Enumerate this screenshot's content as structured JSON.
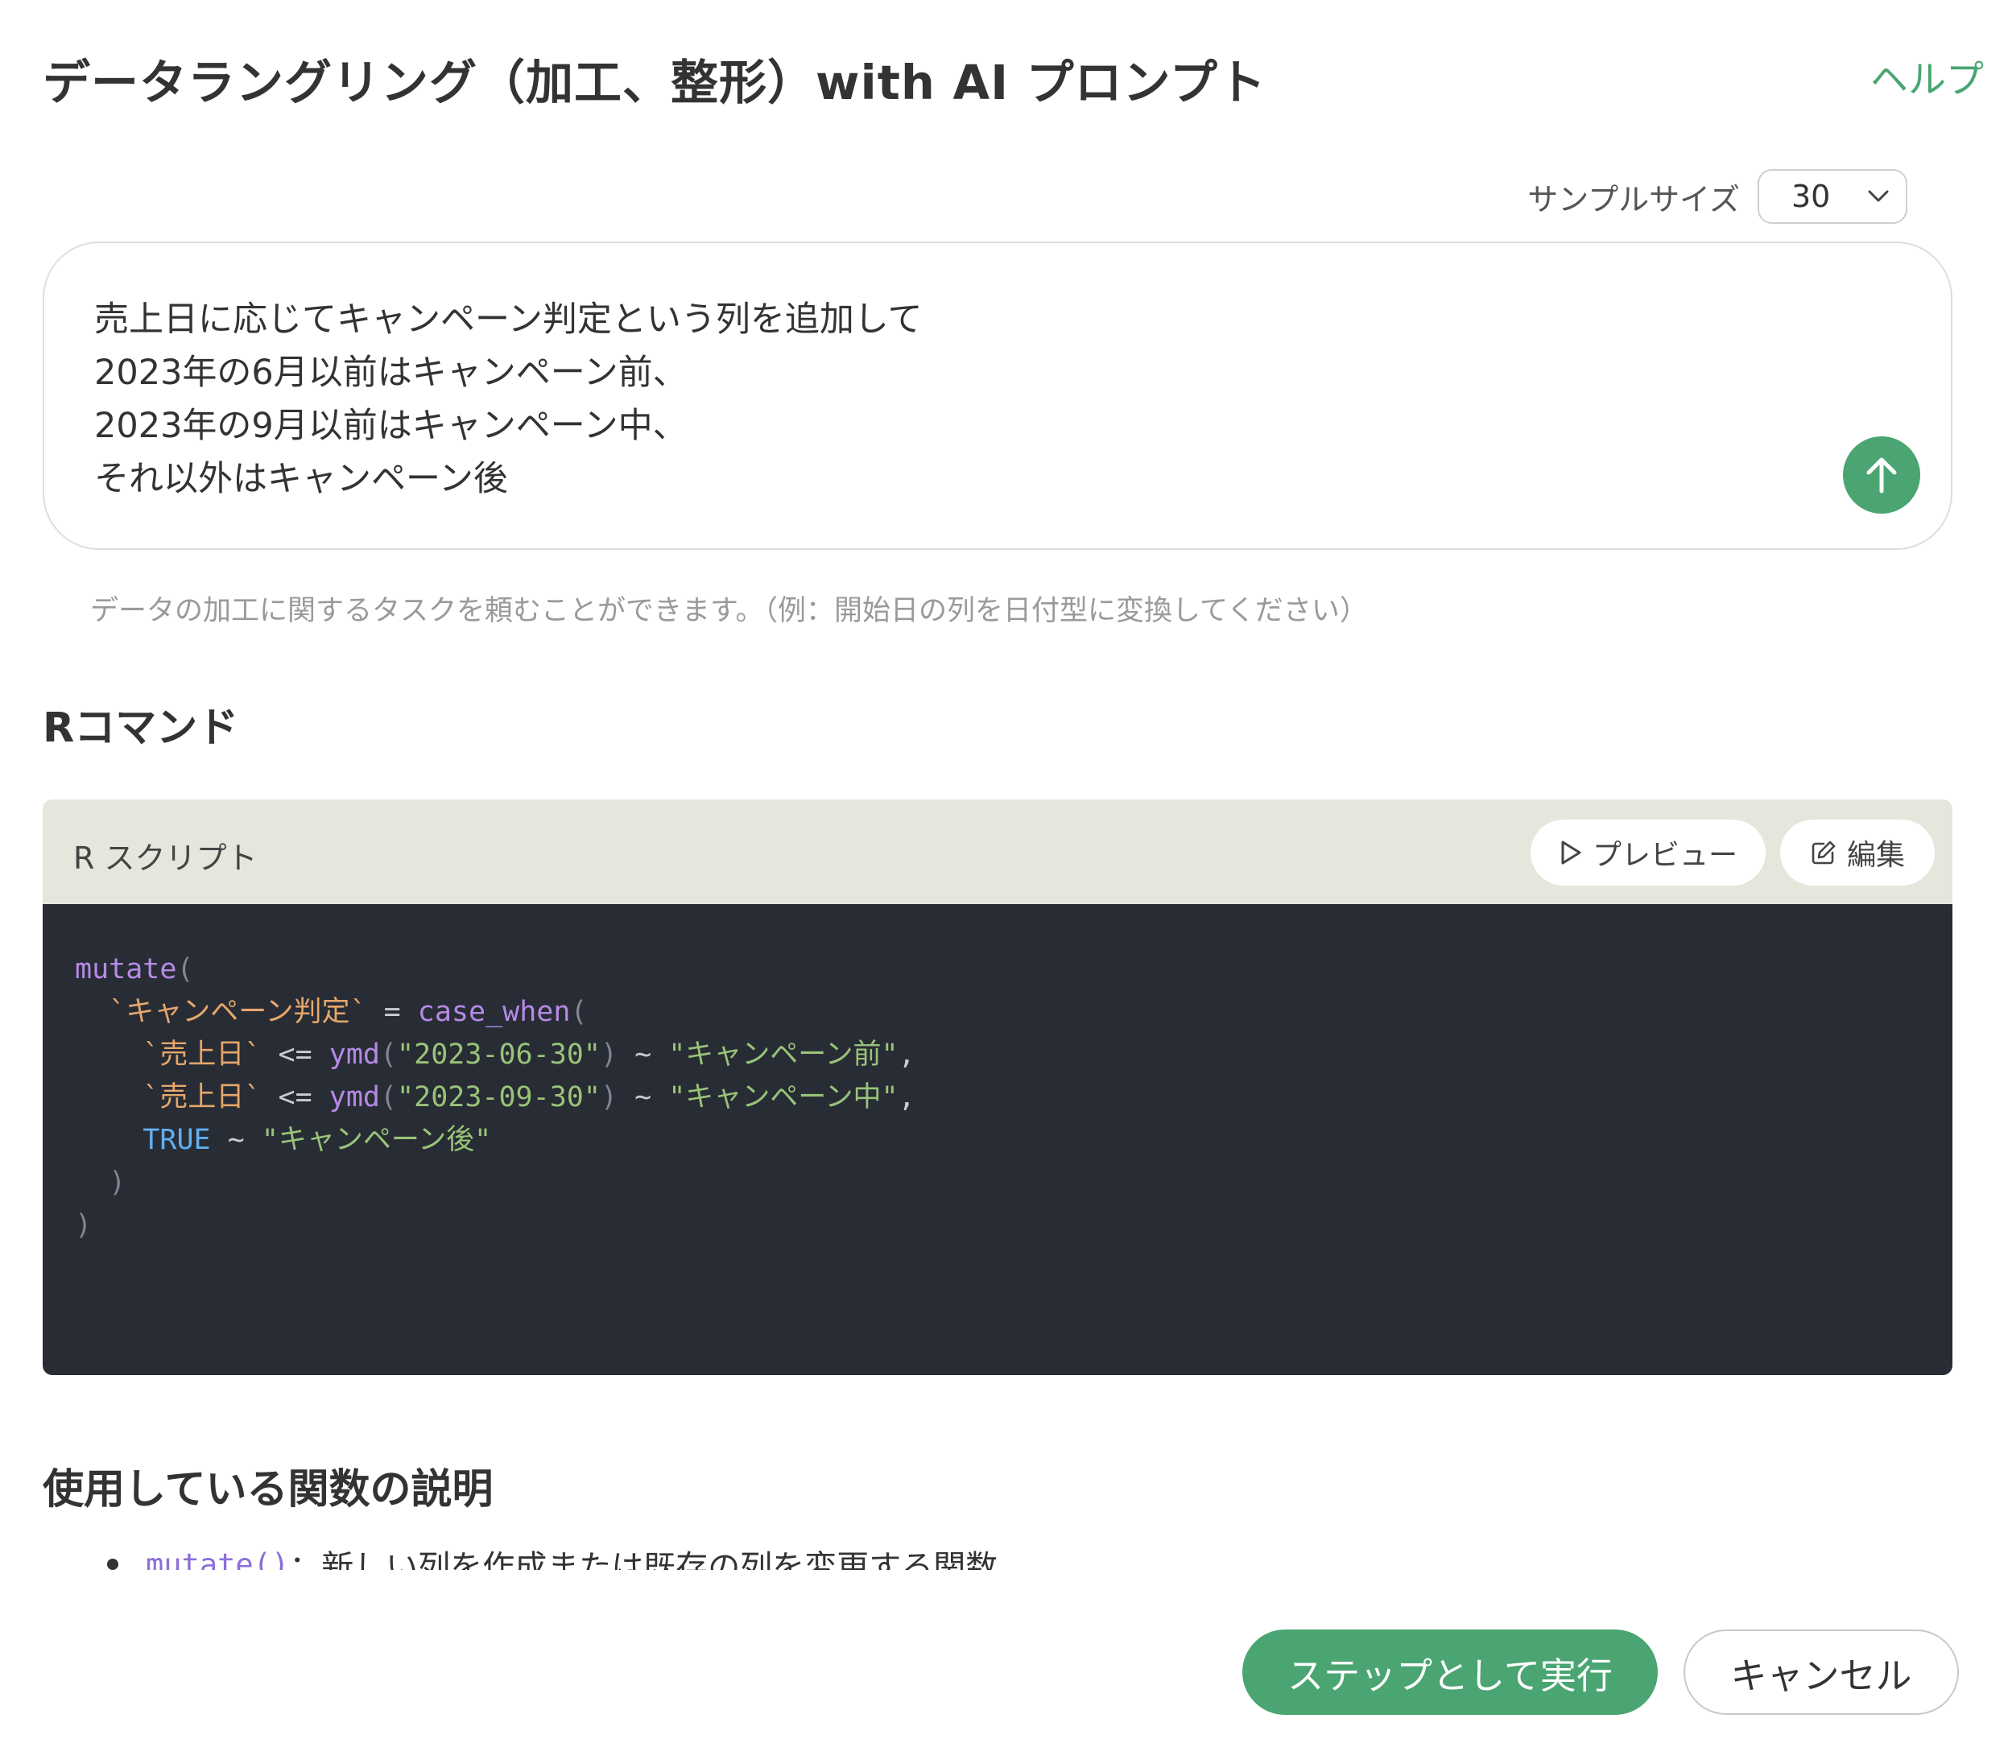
{
  "header": {
    "title": "データラングリング（加工、整形）with AI プロンプト",
    "help_label": "ヘルプ"
  },
  "sample": {
    "label": "サンプルサイズ",
    "value": "30"
  },
  "prompt": {
    "text": "売上日に応じてキャンペーン判定という列を追加して\n2023年の6月以前はキャンペーン前、\n2023年の9月以前はキャンペーン中、\nそれ以外はキャンペーン後",
    "hint": "データの加工に関するタスクを頼むことができます。（例：開始日の列を日付型に変換してください）"
  },
  "r_command": {
    "section_title": "Rコマンド",
    "panel_label": "R スクリプト",
    "preview_label": "プレビュー",
    "edit_label": "編集",
    "code": {
      "l1_fn": "mutate",
      "l1_paren": "(",
      "l2_col": "`キャンペーン判定`",
      "l2_op": " = ",
      "l2_fn": "case_when",
      "l2_paren": "(",
      "l3_col": "`売上日`",
      "l3_op": " <= ",
      "l3_fn": "ymd",
      "l3_open": "(",
      "l3_date": "\"2023-06-30\"",
      "l3_close": ")",
      "l3_tilde": " ~ ",
      "l3_val": "\"キャンペーン前\"",
      "l3_comma": ",",
      "l4_col": "`売上日`",
      "l4_op": " <= ",
      "l4_fn": "ymd",
      "l4_open": "(",
      "l4_date": "\"2023-09-30\"",
      "l4_close": ")",
      "l4_tilde": " ~ ",
      "l4_val": "\"キャンペーン中\"",
      "l4_comma": ",",
      "l5_kw": "TRUE",
      "l5_tilde": " ~ ",
      "l5_val": "\"キャンペーン後\"",
      "l6_paren": ")",
      "l7_paren": ")"
    }
  },
  "functions": {
    "section_title": "使用している関数の説明",
    "items": [
      {
        "code": "mutate()",
        "text": "：新しい列を作成または既存の列を変更する関数"
      }
    ]
  },
  "footer": {
    "run_label": "ステップとして実行",
    "cancel_label": "キャンセル"
  },
  "colors": {
    "accent": "#4aa572",
    "code_bg": "#282c34",
    "code_header_bg": "#e6e6dc"
  }
}
